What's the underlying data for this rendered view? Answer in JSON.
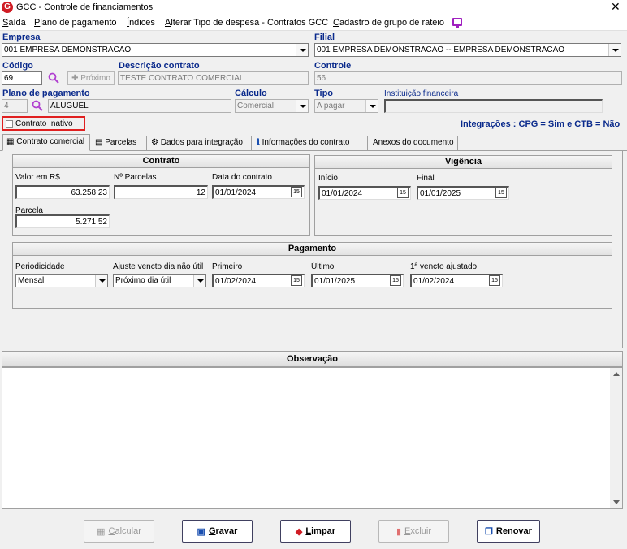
{
  "window": {
    "title": "GCC - Controle de financiamentos",
    "logo": "G"
  },
  "menu": {
    "items": [
      {
        "pre": "",
        "ul": "S",
        "post": "aída"
      },
      {
        "pre": "",
        "ul": "P",
        "post": "lano de pagamento"
      },
      {
        "pre": "",
        "ul": "Í",
        "post": "ndices"
      },
      {
        "pre": "",
        "ul": "A",
        "post": "lterar Tipo de despesa - Contratos GCC"
      },
      {
        "pre": "",
        "ul": "C",
        "post": "adastro de grupo de rateio"
      }
    ]
  },
  "form": {
    "empresa_label": "Empresa",
    "empresa_value": "001 EMPRESA DEMONSTRACAO",
    "filial_label": "Filial",
    "filial_value": "001 EMPRESA DEMONSTRACAO -- EMPRESA DEMONSTRACAO",
    "codigo_label": "Código",
    "codigo_value": "69",
    "proximo_label": "Próximo",
    "descricao_label": "Descrição contrato",
    "descricao_value": "TESTE CONTRATO COMERCIAL",
    "controle_label": "Controle",
    "controle_value": "56",
    "plano_label": "Plano de pagamento",
    "plano_code": "4",
    "plano_value": "ALUGUEL",
    "calculo_label": "Cálculo",
    "calculo_value": "Comercial",
    "tipo_label": "Tipo",
    "tipo_value": "A pagar",
    "instituicao_label": "Instituição financeira",
    "instituicao_value": "",
    "inativo_label": "Contrato Inativo",
    "integracoes": "Integrações : CPG = Sim e CTB = Não"
  },
  "tabs": [
    "Contrato comercial",
    "Parcelas",
    "Dados para integração",
    "Informações do contrato",
    "Anexos do documento"
  ],
  "contrato": {
    "title": "Contrato",
    "valor_label": "Valor em R$",
    "valor": "63.258,23",
    "parcelas_label": "Nº Parcelas",
    "parcelas": "12",
    "data_label": "Data do contrato",
    "data": "01/01/2024",
    "parcela_label": "Parcela",
    "parcela": "5.271,52"
  },
  "vigencia": {
    "title": "Vigência",
    "inicio_label": "Início",
    "inicio": "01/01/2024",
    "final_label": "Final",
    "final": "01/01/2025"
  },
  "pagamento": {
    "title": "Pagamento",
    "periodicidade_label": "Periodicidade",
    "periodicidade": "Mensal",
    "ajuste_label": "Ajuste vencto dia não útil",
    "ajuste": "Próximo dia útil",
    "primeiro_label": "Primeiro",
    "primeiro": "01/02/2024",
    "ultimo_label": "Último",
    "ultimo": "01/01/2025",
    "vencto_label": "1ª vencto ajustado",
    "vencto": "01/02/2024"
  },
  "observacao": {
    "title": "Observação",
    "value": ""
  },
  "buttons": {
    "calcular": {
      "ul": "C",
      "post": "alcular"
    },
    "gravar": {
      "ul": "G",
      "post": "ravar"
    },
    "limpar": {
      "ul": "L",
      "post": "impar"
    },
    "excluir": {
      "ul": "E",
      "post": "xcluir"
    },
    "renovar": "Renovar"
  },
  "date_icon": "15"
}
